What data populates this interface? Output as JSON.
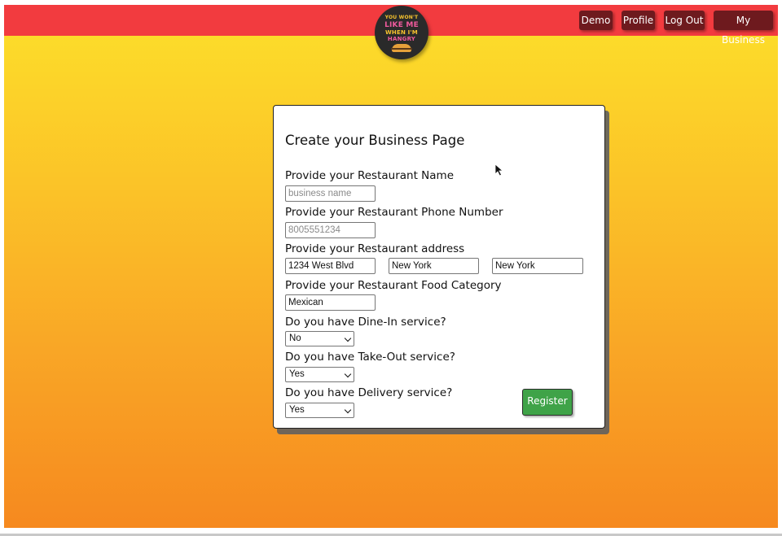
{
  "nav": {
    "logo_alt_lines": [
      "YOU WON'T",
      "LIKE ME",
      "WHEN I'M",
      "HANGRY"
    ],
    "buttons": [
      {
        "label": "Demo"
      },
      {
        "label": "Profile"
      },
      {
        "label": "Log Out"
      },
      {
        "label": "My Business"
      }
    ]
  },
  "form": {
    "title": "Create your Business Page",
    "name_label": "Provide your Restaurant Name",
    "name_placeholder": "business name",
    "phone_label": "Provide your Restaurant Phone Number",
    "phone_placeholder": "8005551234",
    "address_label": "Provide your Restaurant address",
    "address_street": "1234 West Blvd",
    "address_city": "New York",
    "address_state": "New York",
    "category_label": "Provide your Restaurant Food Category",
    "category_value": "Mexican",
    "dinein_label": "Do you have Dine-In service?",
    "dinein_value": "No",
    "takeout_label": "Do you have Take-Out service?",
    "takeout_value": "Yes",
    "delivery_label": "Do you have Delivery service?",
    "delivery_value": "Yes",
    "register_label": "Register"
  },
  "colors": {
    "navbar": "#f23b3f",
    "nav_button": "#6e1a1e",
    "register_button": "#3fa348",
    "background_top": "#fde02a",
    "background_bottom": "#f6891f"
  }
}
